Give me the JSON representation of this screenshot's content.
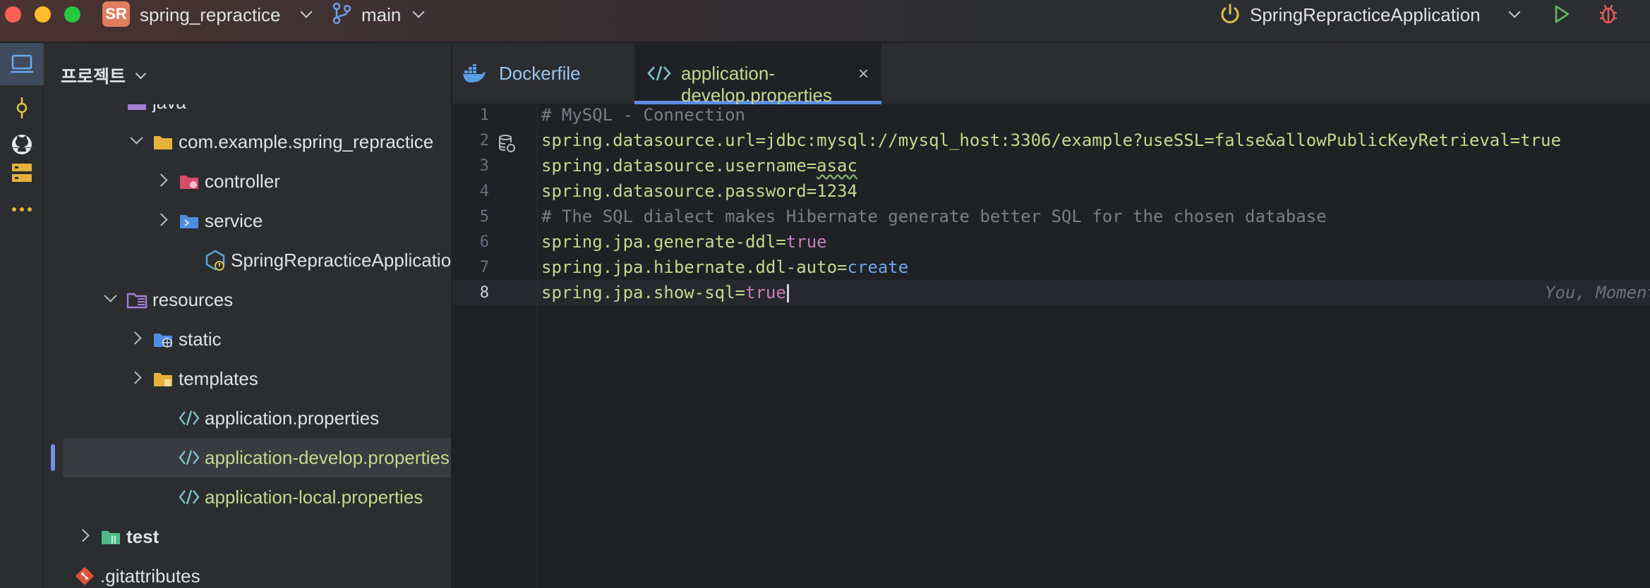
{
  "titlebar": {
    "project_badge": "SR",
    "project_name": "spring_repractice",
    "branch": "main",
    "run_config": "SpringRepracticeApplication"
  },
  "activity_bar": {
    "items": [
      "project-icon",
      "commit-icon",
      "github-icon",
      "services-icon",
      "more-icon"
    ]
  },
  "project_panel": {
    "title": "프로젝트",
    "tree": [
      {
        "label": "java",
        "indent": 2,
        "icon": "folder-source-icon",
        "arrow": "none"
      },
      {
        "label": "com.example.spring_repractice",
        "indent": 3,
        "icon": "folder-icon",
        "arrow": "down"
      },
      {
        "label": "controller",
        "indent": 4,
        "icon": "folder-controller-icon",
        "arrow": "right"
      },
      {
        "label": "service",
        "indent": 4,
        "icon": "folder-service-icon",
        "arrow": "right"
      },
      {
        "label": "SpringRepracticeApplication",
        "indent": 5,
        "icon": "spring-class-icon",
        "arrow": "none"
      },
      {
        "label": "resources",
        "indent": 2,
        "icon": "folder-resources-icon",
        "arrow": "down"
      },
      {
        "label": "static",
        "indent": 3,
        "icon": "folder-web-icon",
        "arrow": "right"
      },
      {
        "label": "templates",
        "indent": 3,
        "icon": "folder-templates-icon",
        "arrow": "right"
      },
      {
        "label": "application.properties",
        "indent": 4,
        "icon": "properties-file-icon",
        "arrow": "none"
      },
      {
        "label": "application-develop.properties",
        "indent": 4,
        "icon": "properties-file-icon",
        "arrow": "none",
        "selected": true,
        "modified": true
      },
      {
        "label": "application-local.properties",
        "indent": 4,
        "icon": "properties-file-icon",
        "arrow": "none",
        "modified": true
      },
      {
        "label": "test",
        "indent": 1,
        "icon": "folder-test-icon",
        "arrow": "right",
        "bold": true
      },
      {
        "label": ".gitattributes",
        "indent": 0,
        "icon": "git-file-icon",
        "arrow": "none"
      }
    ]
  },
  "tabs": [
    {
      "label": "Dockerfile",
      "icon": "docker-icon",
      "active": false
    },
    {
      "label": "application-develop.properties",
      "icon": "properties-file-icon",
      "active": true,
      "close": "×"
    }
  ],
  "editor": {
    "current_line": 8,
    "lines": [
      {
        "num": "1",
        "tokens": [
          {
            "t": "# MySQL - Connection",
            "c": "c-comment"
          }
        ]
      },
      {
        "num": "2",
        "tokens": [
          {
            "t": "spring.datasource.url",
            "c": "c-key"
          },
          {
            "t": "=",
            "c": "c-eq"
          },
          {
            "t": "jdbc:mysql://mysql_host:3306/example?useSSL=false&allowPublicKeyRetrieval=true",
            "c": "c-val"
          }
        ]
      },
      {
        "num": "3",
        "tokens": [
          {
            "t": "spring.datasource.username",
            "c": "c-key"
          },
          {
            "t": "=",
            "c": "c-eq"
          },
          {
            "t": "asac",
            "c": "c-val c-typo"
          }
        ]
      },
      {
        "num": "4",
        "tokens": [
          {
            "t": "spring.datasource.password",
            "c": "c-key"
          },
          {
            "t": "=",
            "c": "c-eq"
          },
          {
            "t": "1234",
            "c": "c-val"
          }
        ]
      },
      {
        "num": "5",
        "tokens": [
          {
            "t": "# The SQL dialect makes Hibernate generate better SQL for the chosen database",
            "c": "c-comment"
          }
        ]
      },
      {
        "num": "6",
        "tokens": [
          {
            "t": "spring.jpa.generate-ddl",
            "c": "c-key"
          },
          {
            "t": "=",
            "c": "c-eq"
          },
          {
            "t": "true",
            "c": "c-kw"
          }
        ]
      },
      {
        "num": "7",
        "tokens": [
          {
            "t": "spring.jpa.hibernate.ddl-auto",
            "c": "c-key"
          },
          {
            "t": "=",
            "c": "c-eq"
          },
          {
            "t": "create",
            "c": "c-create"
          }
        ]
      },
      {
        "num": "8",
        "tokens": [
          {
            "t": "spring.jpa.show-sql",
            "c": "c-key"
          },
          {
            "t": "=",
            "c": "c-eq"
          },
          {
            "t": "true",
            "c": "c-kw"
          }
        ]
      }
    ],
    "blame": "You, Moments ago • Uncommitted changes"
  }
}
